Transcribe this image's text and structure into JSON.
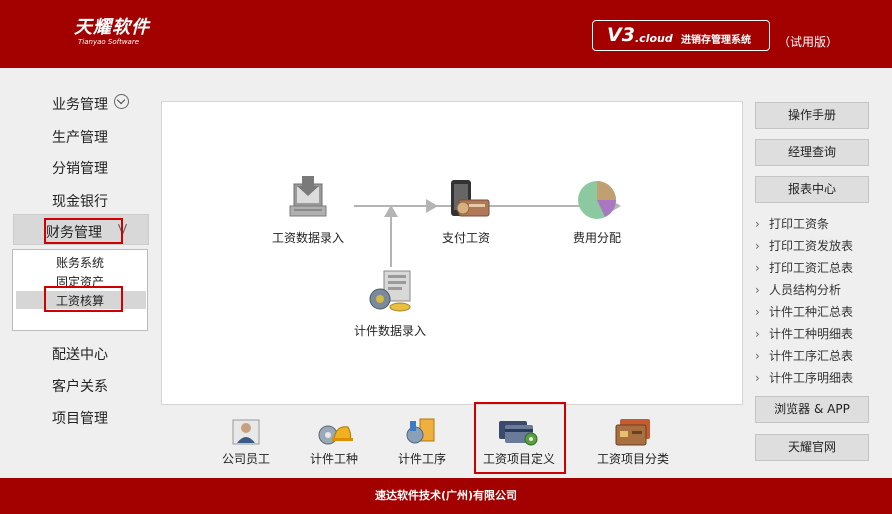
{
  "header": {
    "logo_cn": "天耀软件",
    "logo_en": "Tianyao Software",
    "version_main": "V3",
    "version_cloud": ".cloud",
    "system_name": "进销存管理系统",
    "trial": "（试用版）"
  },
  "nav": {
    "items": [
      "业务管理",
      "生产管理",
      "分销管理",
      "现金银行",
      "财务管理",
      "配送中心",
      "客户关系",
      "项目管理"
    ],
    "finance_sub": [
      "账务系统",
      "固定资产",
      "工资核算"
    ]
  },
  "flow": {
    "wage_entry": "工资数据录入",
    "pay_wage": "支付工资",
    "cost_alloc": "费用分配",
    "piece_entry": "计件数据录入"
  },
  "bottom": {
    "items": [
      "公司员工",
      "计件工种",
      "计件工序",
      "工资项目定义",
      "工资项目分类"
    ]
  },
  "right": {
    "buttons": [
      "操作手册",
      "经理查询",
      "报表中心"
    ],
    "links": [
      "打印工资条",
      "打印工资发放表",
      "打印工资汇总表",
      "人员结构分析",
      "计件工种汇总表",
      "计件工种明细表",
      "计件工序汇总表",
      "计件工序明细表"
    ],
    "browser_app": "浏览器 & APP",
    "official_site": "天耀官网"
  },
  "footer": {
    "company": "速达软件技术(广州)有限公司"
  },
  "colors": {
    "brand_red": "#a30000",
    "highlight_red": "#d00000"
  }
}
